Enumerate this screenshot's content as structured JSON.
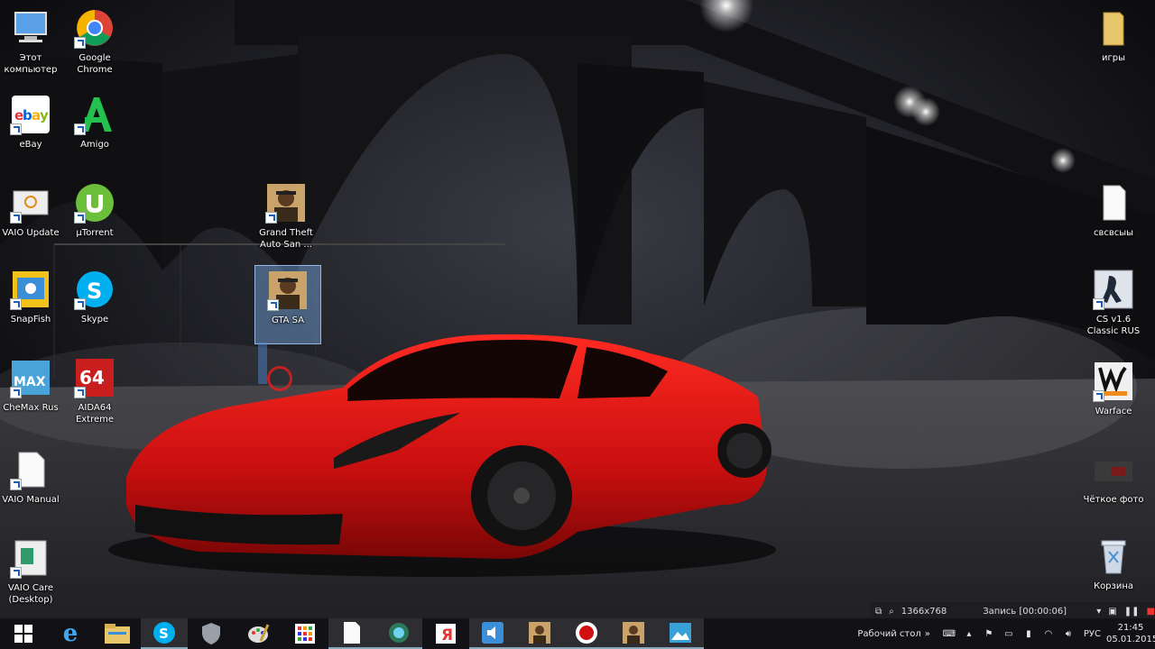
{
  "desktop": {
    "icons_left": [
      {
        "label": "Этот компьютер"
      },
      {
        "label": "Google Chrome"
      },
      {
        "label": "eBay"
      },
      {
        "label": "Amigo"
      },
      {
        "label": "VAIO Update"
      },
      {
        "label": "µTorrent"
      },
      {
        "label": "SnapFish"
      },
      {
        "label": "Skype"
      },
      {
        "label": "CheMax Rus"
      },
      {
        "label": "AIDA64 Extreme"
      },
      {
        "label": "VAIO Manual"
      },
      {
        "label": "VAIO Care (Desktop)"
      },
      {
        "label": "Grand Theft Auto San ..."
      },
      {
        "label": "GTA SA"
      }
    ],
    "icons_right": [
      {
        "label": "игры"
      },
      {
        "label": "свсвсыы"
      },
      {
        "label": "CS v1.6 Classic RUS"
      },
      {
        "label": "Warface"
      },
      {
        "label": "Чёткое фото"
      },
      {
        "label": "Корзина"
      }
    ]
  },
  "recording_bar": {
    "resolution": "1366x768",
    "status": "Запись [00:00:06]"
  },
  "taskbar": {
    "desktop_label": "Рабочий стол",
    "language": "РУС",
    "time": "21:45",
    "date": "05.01.2015"
  },
  "colors": {
    "car": "#d81414",
    "taskbar": "#121216",
    "accent": "#1a5fb4"
  }
}
